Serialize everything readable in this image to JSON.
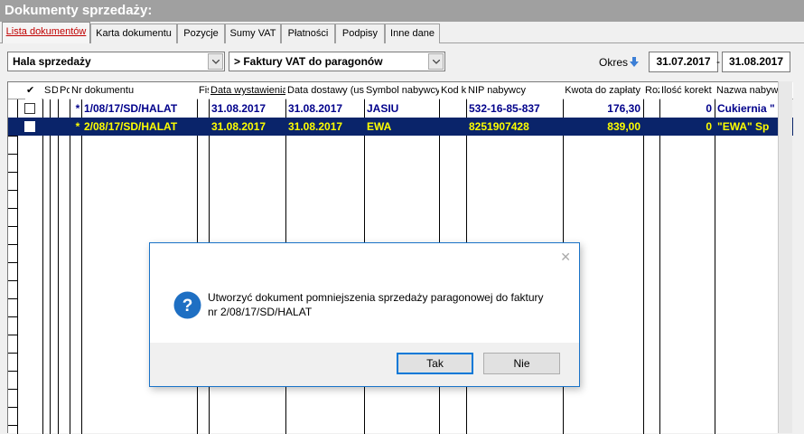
{
  "window": {
    "title": "Dokumenty sprzedaży:"
  },
  "tabs": [
    {
      "label": "Lista dokumentów",
      "active": true
    },
    {
      "label": "Karta dokumentu",
      "active": false
    },
    {
      "label": "Pozycje",
      "active": false
    },
    {
      "label": "Sumy VAT",
      "active": false
    },
    {
      "label": "Płatności",
      "active": false
    },
    {
      "label": "Podpisy",
      "active": false
    },
    {
      "label": "Inne dane",
      "active": false
    }
  ],
  "filters": {
    "register": "Hala sprzedaży",
    "document_type": "> Faktury VAT do paragonów",
    "period_label": "Okres",
    "date_from": "31.07.2017",
    "date_separator": "-",
    "date_to": "31.08.2017"
  },
  "table": {
    "headers": {
      "check": "✔",
      "st": "St",
      "de": "De",
      "po": "Po",
      "nr": "Nr dokumentu",
      "fis": "Fis",
      "data_wyst": "Data wystawienia",
      "data_dost": "Data dostawy (usł",
      "symbol": "Symbol nabywcy",
      "kod": "Kod ki",
      "nip": "NIP nabywcy",
      "kwota": "Kwota do zapłaty",
      "rozliczone": "Rozliczone",
      "ilosc": "Ilość korekt",
      "nazwa": "Nazwa nabywcy"
    },
    "rows": [
      {
        "selected": false,
        "mark": "*",
        "nr": "1/08/17/SD/HALAT",
        "data_wyst": "31.08.2017",
        "data_dost": "31.08.2017",
        "symbol": "JASIU",
        "nip": "532-16-85-837",
        "kwota": "176,30",
        "ilosc": "0",
        "nazwa": "Cukiernia \""
      },
      {
        "selected": true,
        "mark": "*",
        "nr": "2/08/17/SD/HALAT",
        "data_wyst": "31.08.2017",
        "data_dost": "31.08.2017",
        "symbol": "EWA",
        "nip": "8251907428",
        "kwota": "839,00",
        "ilosc": "0",
        "nazwa": "\"EWA\" Sp"
      }
    ]
  },
  "dialog": {
    "icon": "question-icon",
    "message_line1": "Utworzyć dokument pomniejszenia sprzedaży paragonowej do faktury",
    "message_line2": "nr 2/08/17/SD/HALAT",
    "yes_label": "Tak",
    "no_label": "Nie",
    "close_glyph": "✕"
  },
  "colors": {
    "selection_bg": "#0a246a",
    "selection_text": "#ffff00",
    "row_text": "#00008b",
    "active_tab_text": "#c00000",
    "titlebar_bg": "#a0a0a0",
    "dialog_border": "#1a73c8",
    "question_icon": "#1e6fc3"
  }
}
